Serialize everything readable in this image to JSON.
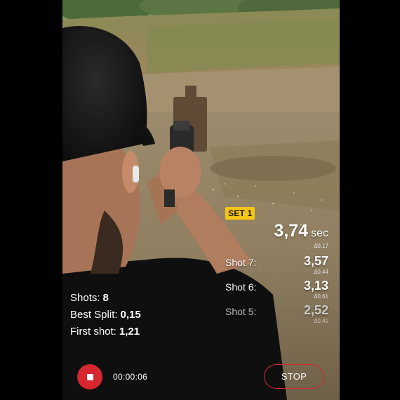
{
  "set_badge": "SET 1",
  "total": {
    "time": "3,74",
    "unit": "sec",
    "delta": "Δ0,17"
  },
  "shots": [
    {
      "label": "Shot 7:",
      "time": "3,57",
      "delta": "Δ0,44"
    },
    {
      "label": "Shot 6:",
      "time": "3,13",
      "delta": "Δ0,61"
    },
    {
      "label": "Shot 5:",
      "time": "2,52",
      "delta": "Δ0,41"
    }
  ],
  "stats": {
    "shots_label": "Shots:",
    "shots_value": "8",
    "best_split_label": "Best Split:",
    "best_split_value": "0,15",
    "first_shot_label": "First shot:",
    "first_shot_value": "1,21"
  },
  "timer": "00:00:06",
  "stop_label": "STOP",
  "colors": {
    "accent": "#d6262f",
    "badge": "#f6c617"
  },
  "icons": {
    "record": "stop-record-icon"
  }
}
